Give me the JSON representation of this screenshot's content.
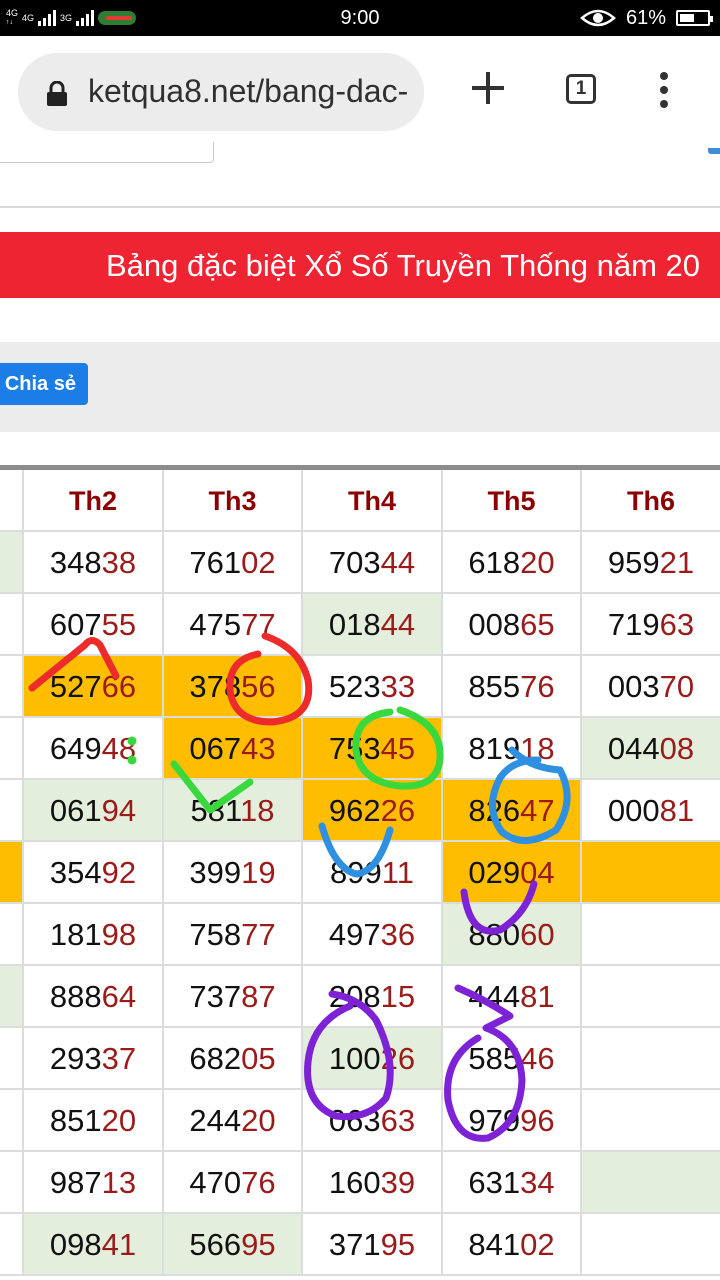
{
  "status_bar": {
    "network_1": "4G",
    "network_2": "4G",
    "network_3": "3G",
    "time": "9:00",
    "battery_percent": "61%"
  },
  "browser": {
    "url": "ketqua8.net/bang-dac-",
    "tab_count": "1"
  },
  "page": {
    "banner_title": "Bảng đặc biệt Xổ Số Truyền Thống năm 20",
    "share_label": "Chia sẻ",
    "table": {
      "columns": [
        "",
        "Th2",
        "Th3",
        "Th4",
        "Th5",
        "Th6"
      ],
      "rows": [
        [
          {
            "v": "",
            "bg": "green"
          },
          {
            "v": "34838"
          },
          {
            "v": "76102"
          },
          {
            "v": "70344"
          },
          {
            "v": "61820"
          },
          {
            "v": "95921"
          }
        ],
        [
          {
            "v": ""
          },
          {
            "v": "60755"
          },
          {
            "v": "47577"
          },
          {
            "v": "01844",
            "bg": "green"
          },
          {
            "v": "00865"
          },
          {
            "v": "71963"
          }
        ],
        [
          {
            "v": ""
          },
          {
            "v": "52766",
            "bg": "orange"
          },
          {
            "v": "37856",
            "bg": "orange"
          },
          {
            "v": "52333"
          },
          {
            "v": "85576"
          },
          {
            "v": "00370"
          }
        ],
        [
          {
            "v": ""
          },
          {
            "v": "64948"
          },
          {
            "v": "06743",
            "bg": "orange"
          },
          {
            "v": "75345",
            "bg": "orange"
          },
          {
            "v": "81918"
          },
          {
            "v": "04408",
            "bg": "green"
          }
        ],
        [
          {
            "v": ""
          },
          {
            "v": "06194",
            "bg": "green"
          },
          {
            "v": "58118",
            "bg": "green"
          },
          {
            "v": "96226",
            "bg": "orange"
          },
          {
            "v": "82647",
            "bg": "orange"
          },
          {
            "v": "00081"
          }
        ],
        [
          {
            "v": "",
            "bg": "orange"
          },
          {
            "v": "35492"
          },
          {
            "v": "39919"
          },
          {
            "v": "89911"
          },
          {
            "v": "02904",
            "bg": "orange"
          },
          {
            "v": "",
            "bg": "orange"
          }
        ],
        [
          {
            "v": ""
          },
          {
            "v": "18198"
          },
          {
            "v": "75877"
          },
          {
            "v": "49736"
          },
          {
            "v": "88060",
            "bg": "green"
          },
          {
            "v": ""
          }
        ],
        [
          {
            "v": "",
            "bg": "green"
          },
          {
            "v": "88864"
          },
          {
            "v": "73787"
          },
          {
            "v": "20815"
          },
          {
            "v": "44481"
          },
          {
            "v": ""
          }
        ],
        [
          {
            "v": ""
          },
          {
            "v": "29337"
          },
          {
            "v": "68205"
          },
          {
            "v": "10026",
            "bg": "green"
          },
          {
            "v": "58546"
          },
          {
            "v": ""
          }
        ],
        [
          {
            "v": ""
          },
          {
            "v": "85120"
          },
          {
            "v": "24420"
          },
          {
            "v": "06363"
          },
          {
            "v": "97996"
          },
          {
            "v": ""
          }
        ],
        [
          {
            "v": ""
          },
          {
            "v": "98713"
          },
          {
            "v": "47076"
          },
          {
            "v": "16039"
          },
          {
            "v": "63134"
          },
          {
            "v": "",
            "bg": "green"
          }
        ],
        [
          {
            "v": ""
          },
          {
            "v": "09841",
            "bg": "green"
          },
          {
            "v": "56695",
            "bg": "green"
          },
          {
            "v": "37195"
          },
          {
            "v": "84102"
          },
          {
            "v": ""
          }
        ]
      ]
    }
  },
  "colors": {
    "banner": "#ee2433",
    "share_button": "#1a7ee6",
    "header_text": "#8b0000",
    "tail_digits": "#9b1b1b",
    "highlight_orange": "#ffbd00",
    "highlight_green": "#e3efdc"
  },
  "icons": {
    "lock": "lock-icon",
    "new_tab": "plus-icon",
    "menu": "more-vertical-icon",
    "eye": "eye-icon"
  }
}
